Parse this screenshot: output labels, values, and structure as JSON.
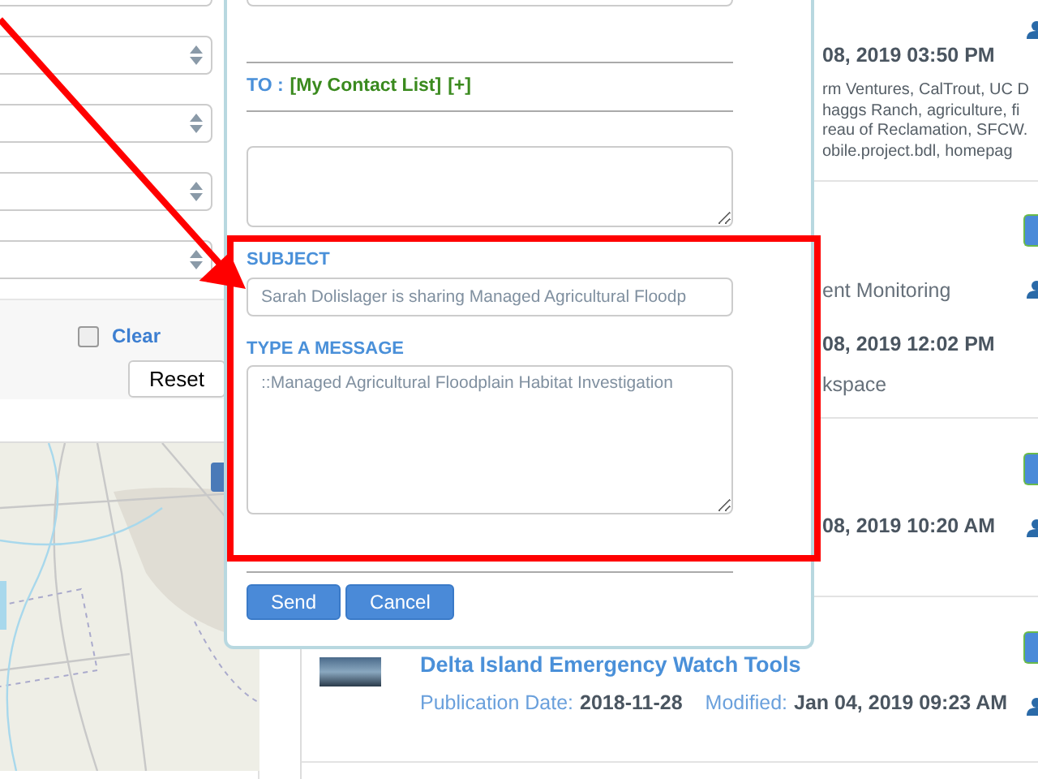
{
  "filters": {
    "clear": {
      "label": "Clear",
      "checked": false
    },
    "reset_button": "Reset"
  },
  "share_dialog": {
    "to_label": "TO :",
    "contact_link": "[My Contact List]",
    "add_link": "[+]",
    "subject_label": "SUBJECT",
    "subject_value": "Sarah Dolislager is sharing Managed Agricultural Floodp",
    "message_label": "TYPE A MESSAGE",
    "message_value": "::Managed Agricultural Floodplain Habitat Investigation",
    "buttons": [
      "Send",
      "Cancel"
    ]
  },
  "results": [
    {
      "date": "08, 2019 03:50 PM",
      "keywords": [
        "rm Ventures, CalTrout, UC D",
        "haggs Ranch, agriculture, fi",
        "reau of Reclamation, SFCW.",
        "obile.project.bdl, homepag"
      ]
    },
    {
      "category": "ent Monitoring",
      "date": "08, 2019 12:02 PM",
      "workspace": "kspace"
    },
    {
      "date": "08, 2019 10:20 AM"
    },
    {
      "title": "Delta Island Emergency Watch Tools",
      "publication_label": "Publication Date:",
      "publication_date": "2018-11-28",
      "modified_label": "Modified:",
      "modified_date": "Jan 04, 2019 09:23 AM"
    }
  ]
}
